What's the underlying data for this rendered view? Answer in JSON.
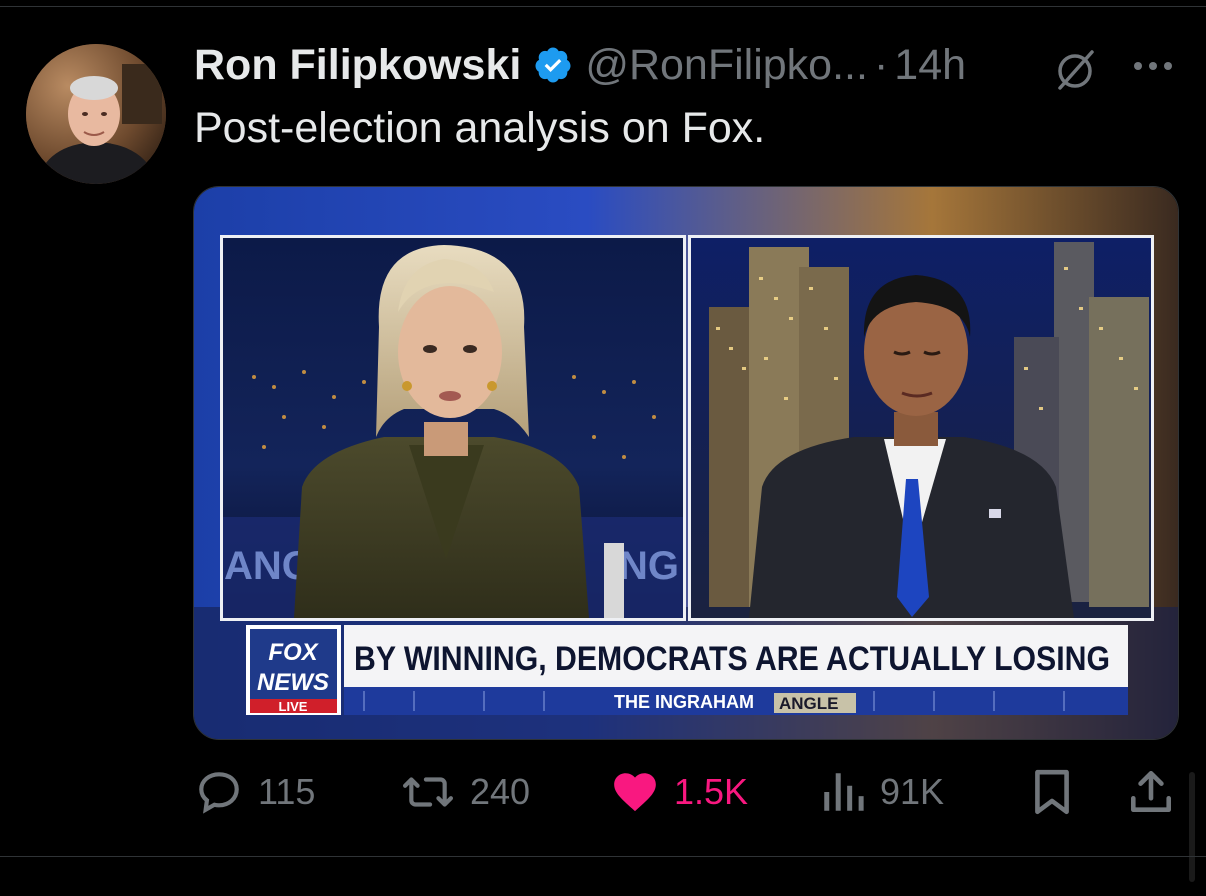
{
  "tweet": {
    "author_name": "Ron Filipkowski",
    "handle": "@RonFilipko...",
    "separator": "·",
    "time": "14h",
    "text": "Post-election analysis on Fox.",
    "verified_color": "#1d9bf0"
  },
  "media": {
    "chyron_headline": "BY WINNING, DEMOCRATS ARE ACTUALLY LOSING",
    "network_line1": "FOX",
    "network_line2": "NEWS",
    "network_live": "LIVE",
    "show_name_part1": "THE INGRAHAM",
    "show_name_part2": "ANGLE",
    "left_backdrop_text": "ANG",
    "right_backdrop_text": "NG"
  },
  "actions": {
    "replies": "115",
    "reposts": "240",
    "likes": "1.5K",
    "views": "91K",
    "like_color": "#f91880",
    "muted_color": "#71767b"
  },
  "icons": [
    "grok-icon",
    "more-icon",
    "reply-icon",
    "repost-icon",
    "heart-icon",
    "views-icon",
    "bookmark-icon",
    "share-icon",
    "verified-icon"
  ]
}
